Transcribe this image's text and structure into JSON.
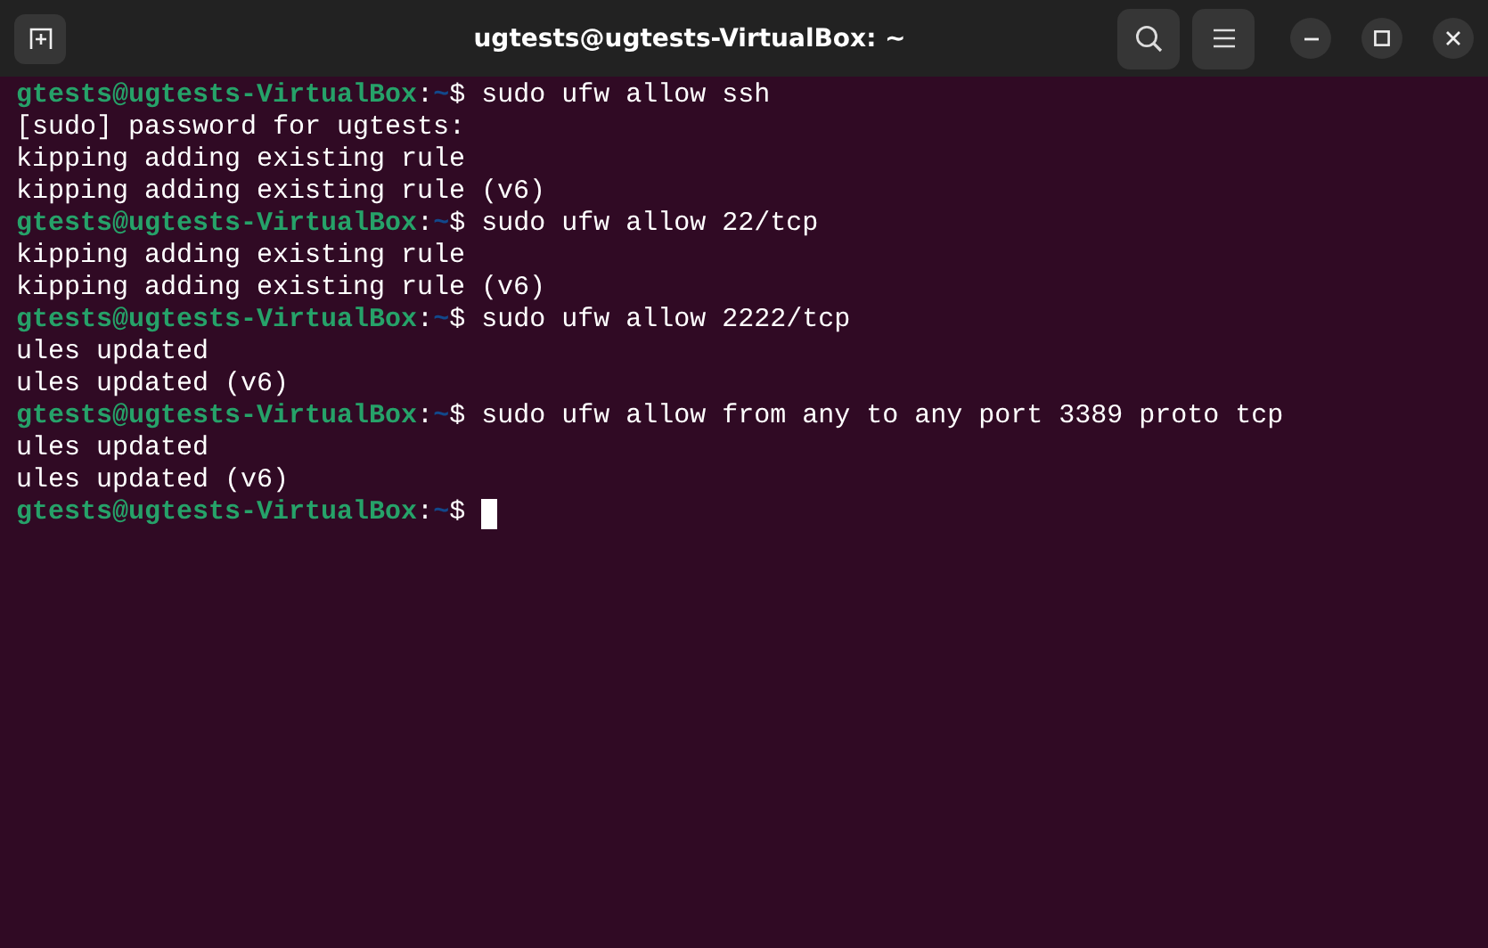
{
  "window": {
    "title": "ugtests@ugtests-VirtualBox: ~"
  },
  "lines": [
    {
      "kind": "prompt",
      "user_host": "gtests@ugtests-VirtualBox",
      "separator": ":",
      "path": "~",
      "symbol": "$",
      "command": "sudo ufw allow ssh"
    },
    {
      "kind": "output",
      "text": "[sudo] password for ugtests:"
    },
    {
      "kind": "output",
      "text": "kipping adding existing rule"
    },
    {
      "kind": "output",
      "text": "kipping adding existing rule (v6)"
    },
    {
      "kind": "prompt",
      "user_host": "gtests@ugtests-VirtualBox",
      "separator": ":",
      "path": "~",
      "symbol": "$",
      "command": "sudo ufw allow 22/tcp"
    },
    {
      "kind": "output",
      "text": "kipping adding existing rule"
    },
    {
      "kind": "output",
      "text": "kipping adding existing rule (v6)"
    },
    {
      "kind": "prompt",
      "user_host": "gtests@ugtests-VirtualBox",
      "separator": ":",
      "path": "~",
      "symbol": "$",
      "command": "sudo ufw allow 2222/tcp"
    },
    {
      "kind": "output",
      "text": "ules updated"
    },
    {
      "kind": "output",
      "text": "ules updated (v6)"
    },
    {
      "kind": "prompt",
      "user_host": "gtests@ugtests-VirtualBox",
      "separator": ":",
      "path": "~",
      "symbol": "$",
      "command": "sudo ufw allow from any to any port 3389 proto tcp"
    },
    {
      "kind": "output",
      "text": "ules updated"
    },
    {
      "kind": "output",
      "text": "ules updated (v6)"
    },
    {
      "kind": "prompt",
      "user_host": "gtests@ugtests-VirtualBox",
      "separator": ":",
      "path": "~",
      "symbol": "$"
    }
  ],
  "cursor_visible": true
}
